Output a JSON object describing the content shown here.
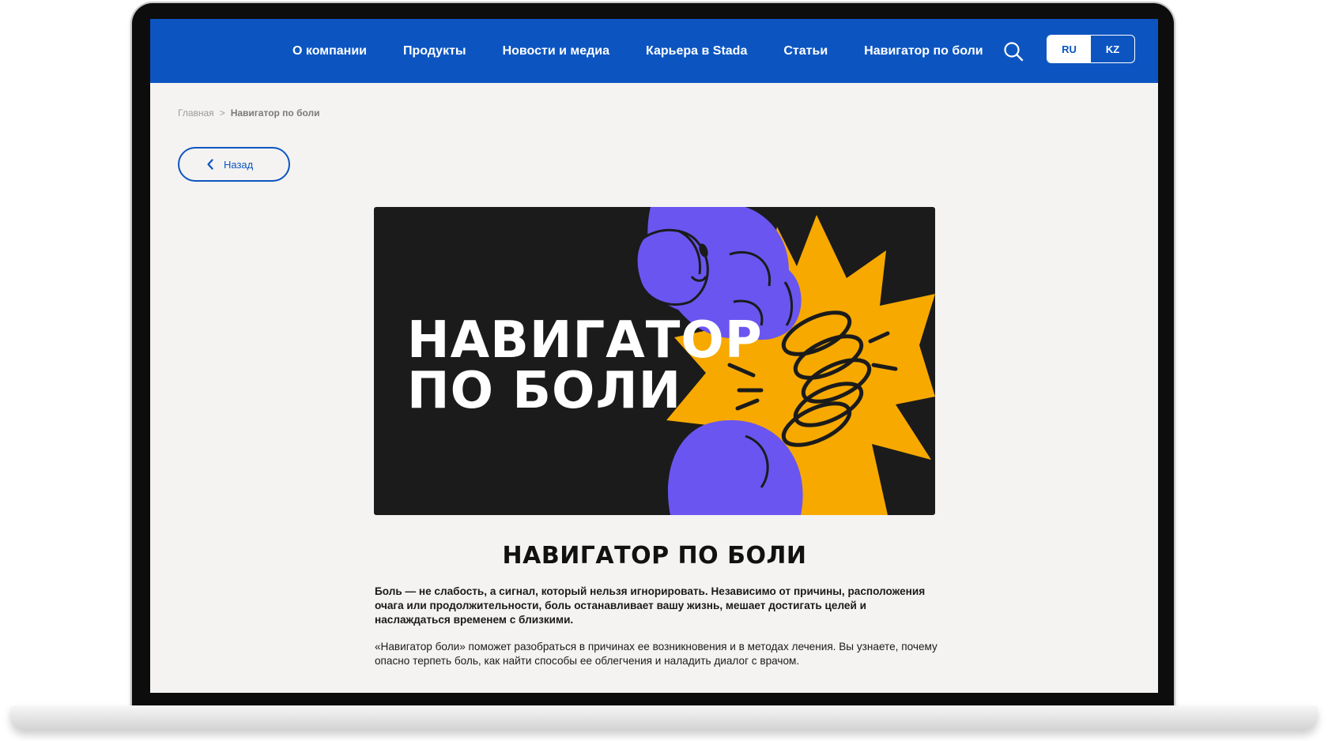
{
  "nav": {
    "items": [
      {
        "label": "О компании"
      },
      {
        "label": "Продукты"
      },
      {
        "label": "Новости и медиа"
      },
      {
        "label": "Карьера в Stada"
      },
      {
        "label": "Статьи"
      },
      {
        "label": "Навигатор по боли"
      }
    ],
    "search_icon": "search-icon",
    "languages": [
      {
        "label": "RU",
        "active": true
      },
      {
        "label": "KZ",
        "active": false
      }
    ]
  },
  "breadcrumb": {
    "home": "Главная",
    "separator": ">",
    "current": "Навигатор по боли"
  },
  "back_button": {
    "label": "Назад",
    "icon": "chevron-left-icon"
  },
  "hero": {
    "title_line1": "НАВИГАТОР",
    "title_line2": "ПО БОЛИ",
    "colors": {
      "background": "#1b1b1b",
      "figure": "#6a55f0",
      "burst": "#f7a900"
    }
  },
  "article": {
    "title": "НАВИГАТОР ПО БОЛИ",
    "paragraph1": "Боль — не слабость, а сигнал, который нельзя игнорировать. Независимо от причины, расположения очага или продолжительности, боль останавливает вашу жизнь, мешает достигать целей и наслаждаться временем с близкими.",
    "paragraph2": "«Навигатор боли» поможет разобраться в причинах ее возникновения и в методах лечения. Вы узнаете, почему опасно терпеть боль, как найти способы ее облегчения и наладить диалог с врачом."
  },
  "colors": {
    "brand_blue": "#0c55c1",
    "page_bg": "#f4f3f1",
    "text": "#1a1a1a"
  }
}
